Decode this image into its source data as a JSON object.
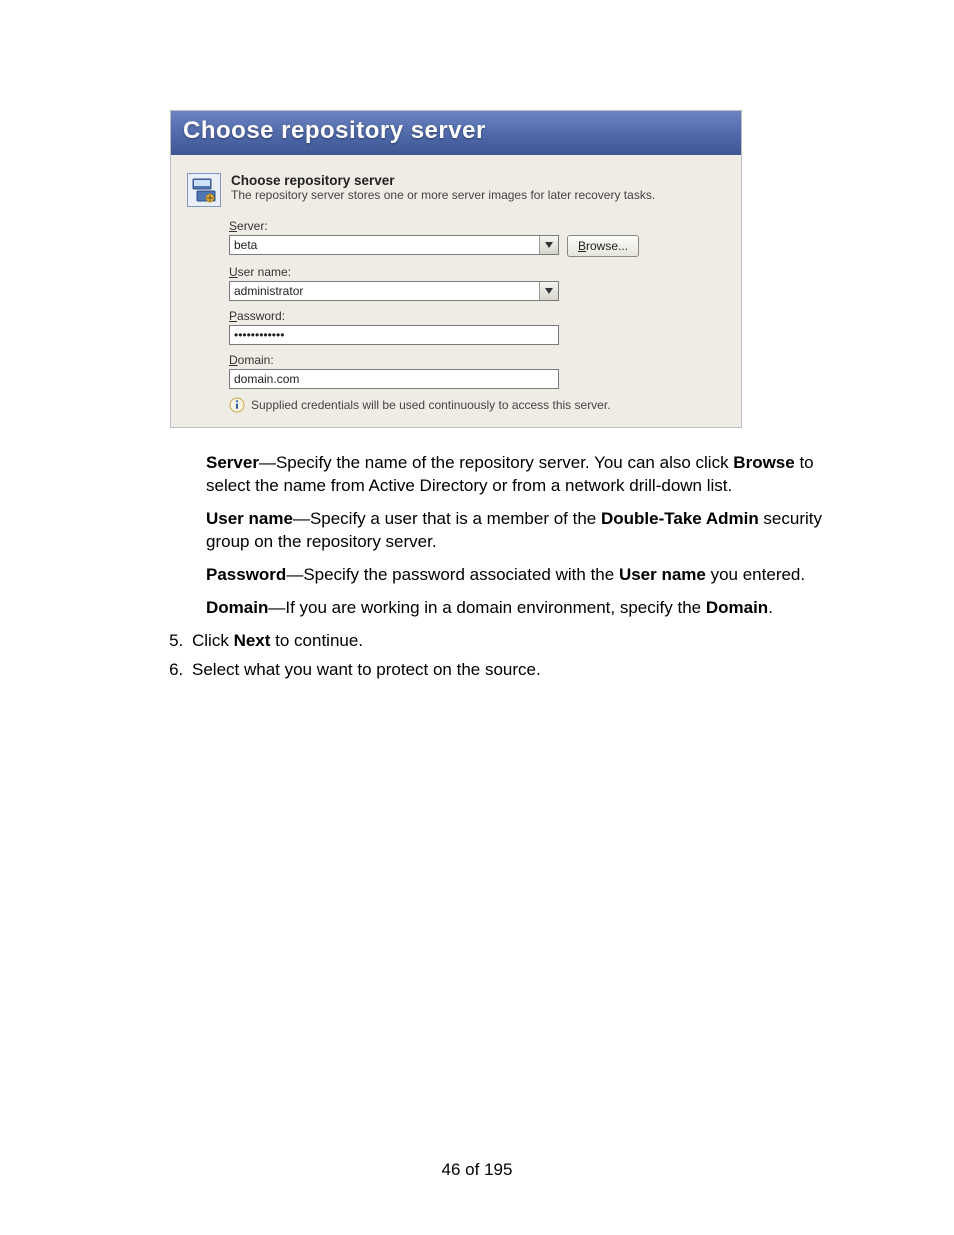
{
  "panel": {
    "title": "Choose repository server",
    "heading": "Choose repository server",
    "sub": "The repository server stores one or more server images for later recovery tasks.",
    "fields": {
      "server_label_pre": "S",
      "server_label_ul": "",
      "server_label_post": "erver:",
      "server_value": "beta",
      "browse_pre": "",
      "browse_ul": "B",
      "browse_post": "rowse...",
      "user_label_pre": "",
      "user_label_ul": "U",
      "user_label_post": "ser name:",
      "user_value": "administrator",
      "pass_label_pre": "",
      "pass_label_ul": "P",
      "pass_label_post": "assword:",
      "pass_value": "••••••••••••",
      "domain_label_pre": "",
      "domain_label_ul": "D",
      "domain_label_post": "omain:",
      "domain_value": "domain.com"
    },
    "info": "Supplied credentials will be used continuously to access this server."
  },
  "doc": {
    "p1a": "Server",
    "p1b": "—Specify the name of the repository server. You can also click ",
    "p1c": "Browse",
    "p1d": " to select the name from Active Directory or from a network drill-down list.",
    "p2a": "User name",
    "p2b": "—Specify a user that is a member of the ",
    "p2c": "Double-Take Admin",
    "p2d": " security group on the repository server.",
    "p3a": "Password",
    "p3b": "—Specify the password associated with the ",
    "p3c": "User name",
    "p3d": " you entered.",
    "p4a": "Domain",
    "p4b": "—If you are working in a domain environment, specify the ",
    "p4c": "Domain",
    "p4d": "."
  },
  "steps": {
    "s5a": "Click ",
    "s5b": "Next",
    "s5c": " to continue.",
    "s6": "Select what you want to protect on the source."
  },
  "pagenum": "46 of 195"
}
